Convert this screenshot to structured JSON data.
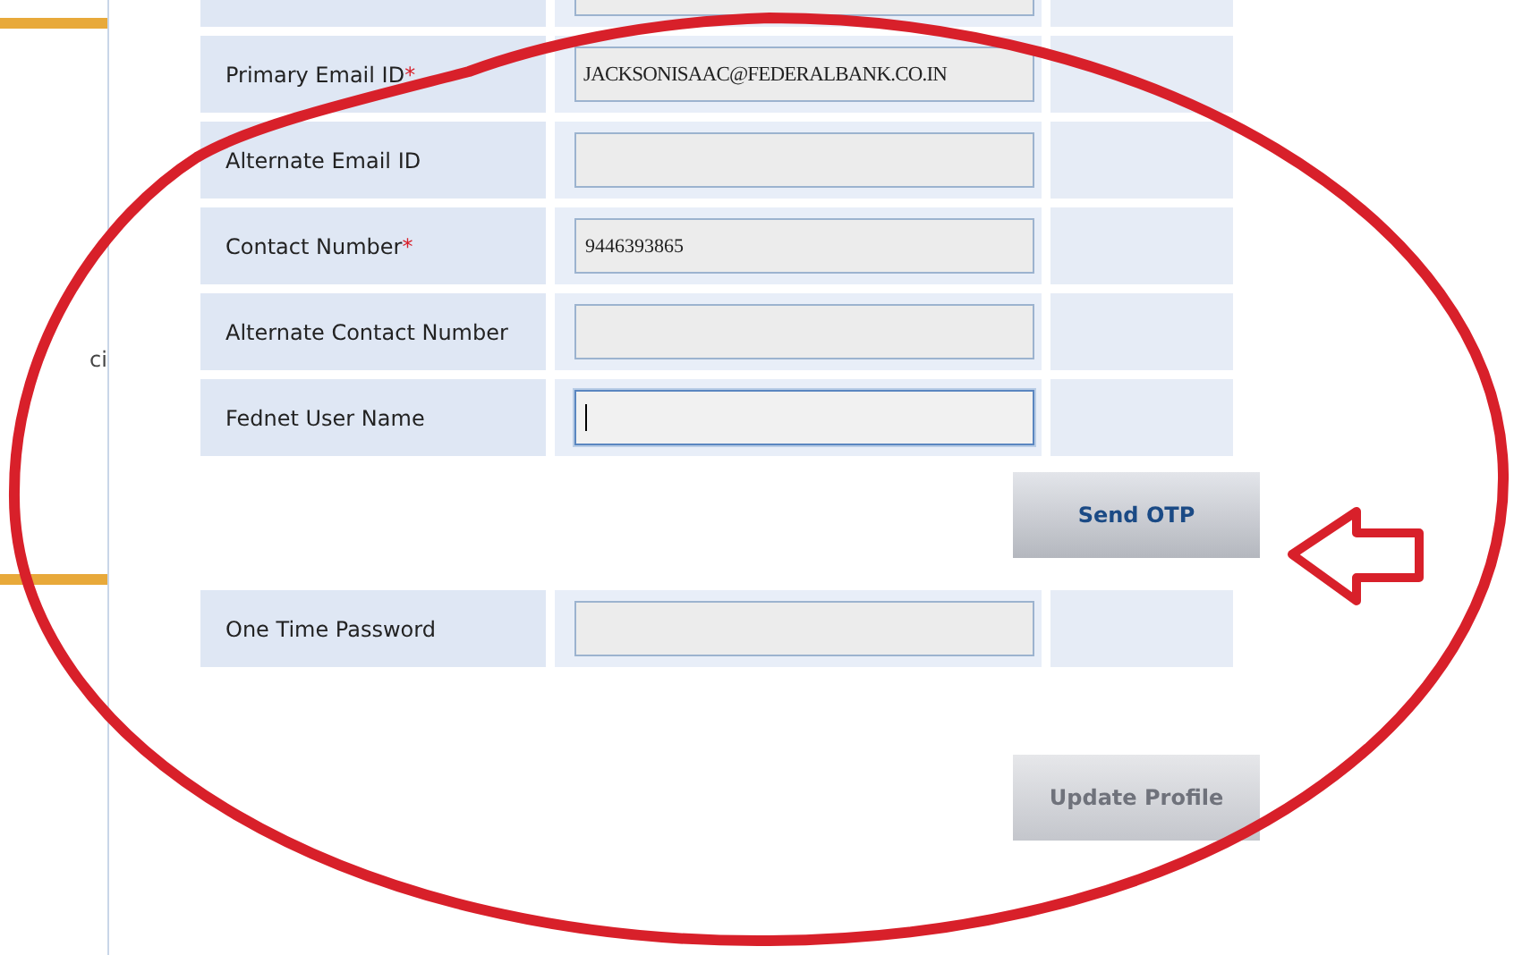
{
  "sidebar": {
    "fragment": "ci"
  },
  "form": {
    "rows": [
      {
        "label": "Primary Email ID",
        "mark": "*",
        "value": "JACKSONISAAC@FEDERALBANK.CO.IN",
        "focused": false
      },
      {
        "label": "Alternate Email ID",
        "focused": false
      },
      {
        "label": "Contact Number",
        "mark": "*",
        "value": "9446393865",
        "focused": false
      },
      {
        "label": "Alternate Contact Number",
        "focused": false
      },
      {
        "label": "Fednet User Name",
        "focused": true
      }
    ],
    "send_button": {
      "label": "Send OTP",
      "disabled": false
    },
    "otp_row": {
      "label": "One Time Password",
      "focused": false
    },
    "update_button": {
      "label": "Update Profile",
      "disabled": true
    }
  }
}
